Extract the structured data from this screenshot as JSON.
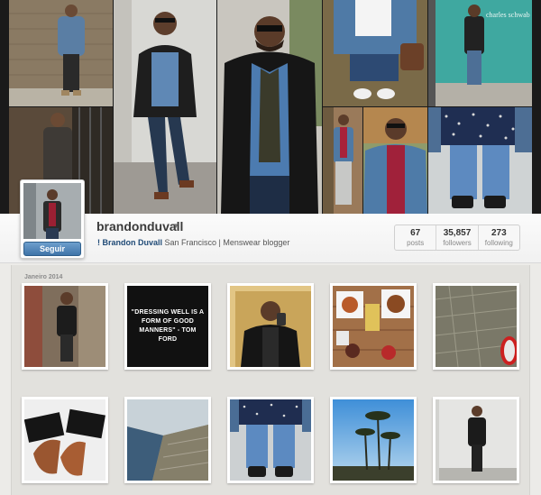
{
  "profile": {
    "username": "brandonduvall",
    "full_name": "! Brandon Duvall",
    "bio": "San Francisco | Menswear blogger",
    "follow_label": "Seguir"
  },
  "stats": [
    {
      "value": "67",
      "label": "posts"
    },
    {
      "value": "35,857",
      "label": "followers"
    },
    {
      "value": "273",
      "label": "following"
    }
  ],
  "feed": {
    "month": "Janeiro 2014",
    "quote": "\"DRESSING WELL IS A FORM OF GOOD MANNERS\" - TOM FORD"
  },
  "header_text": {
    "store_sign": "charles schwab"
  },
  "colors": {
    "follow_button": "#3f74a8",
    "name_link": "#1f4a76",
    "background": "#ecebe8"
  }
}
